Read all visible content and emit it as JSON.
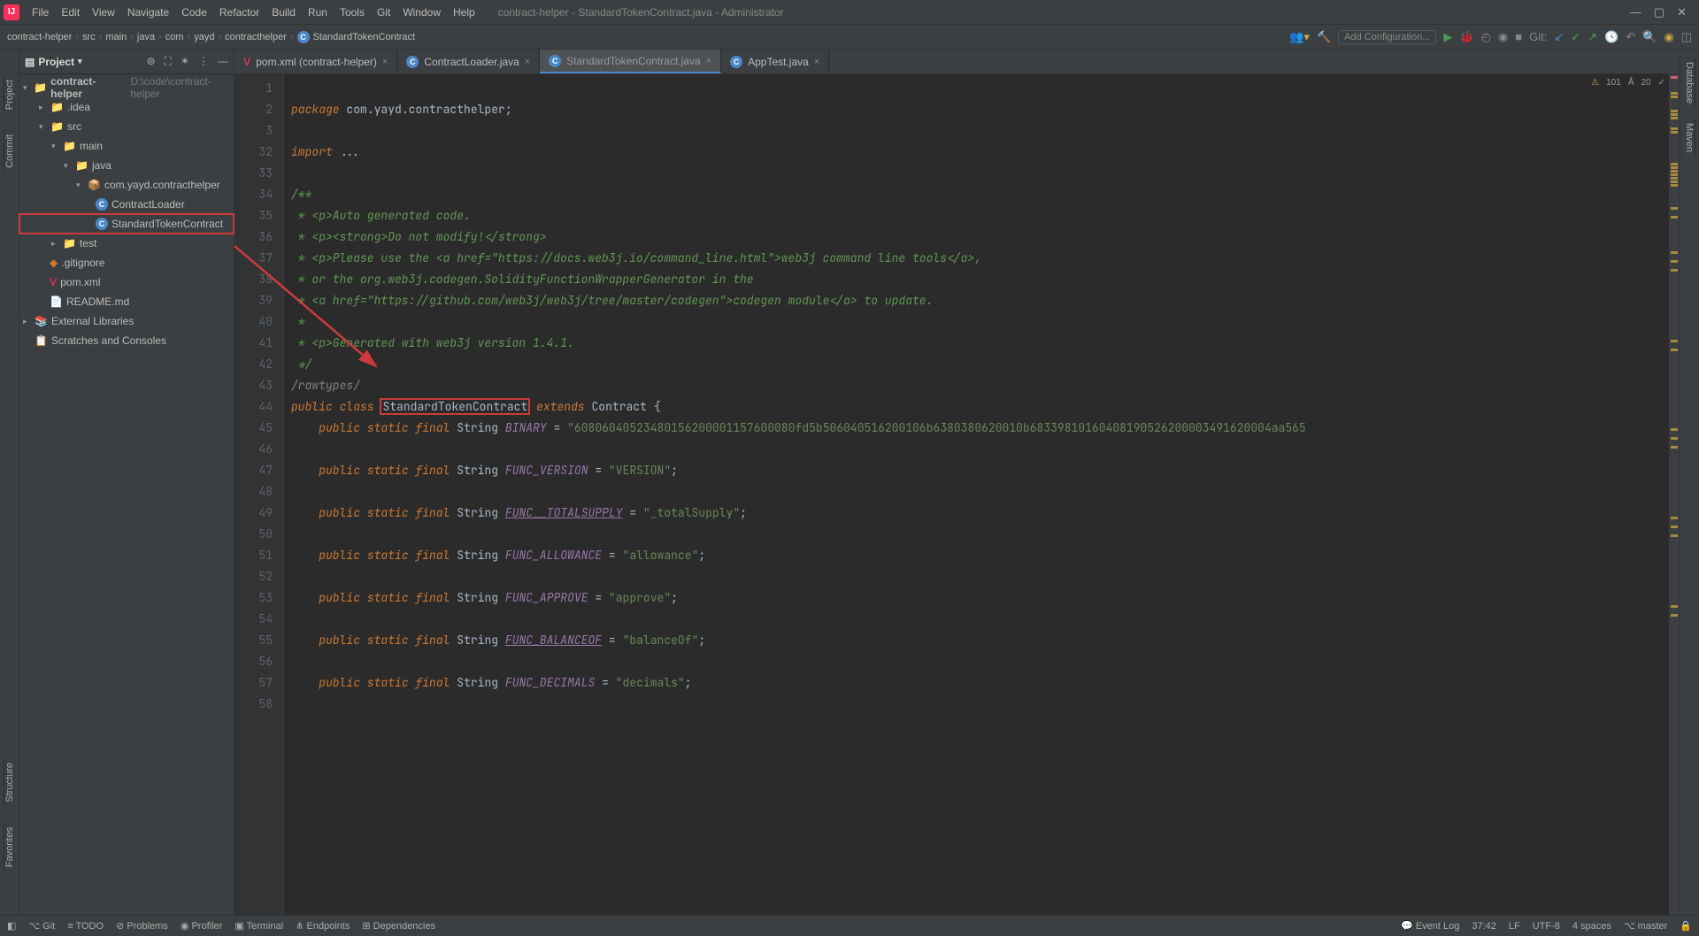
{
  "title": "contract-helper - StandardTokenContract.java - Administrator",
  "menus": [
    "File",
    "Edit",
    "View",
    "Navigate",
    "Code",
    "Refactor",
    "Build",
    "Run",
    "Tools",
    "Git",
    "Window",
    "Help"
  ],
  "breadcrumbs": [
    "contract-helper",
    "src",
    "main",
    "java",
    "com",
    "yayd",
    "contracthelper",
    "StandardTokenContract"
  ],
  "add_config": "Add Configuration...",
  "git_label": "Git:",
  "left_tabs": {
    "project": "Project",
    "commit": "Commit",
    "structure": "Structure",
    "favorites": "Favorites"
  },
  "right_tabs": {
    "database": "Database",
    "maven": "Maven"
  },
  "project_panel": {
    "title": "Project",
    "root": "contract-helper",
    "root_path": "D:\\code\\contract-helper"
  },
  "tree": {
    "idea": ".idea",
    "src": "src",
    "main": "main",
    "java": "java",
    "pkg": "com.yayd.contracthelper",
    "cl": "ContractLoader",
    "stc": "StandardTokenContract",
    "test": "test",
    "gitignore": ".gitignore",
    "pom": "pom.xml",
    "readme": "README.md",
    "ext": "External Libraries",
    "scratches": "Scratches and Consoles"
  },
  "tabs": [
    {
      "label": "pom.xml (contract-helper)"
    },
    {
      "label": "ContractLoader.java"
    },
    {
      "label": "StandardTokenContract.java",
      "active": true
    },
    {
      "label": "AppTest.java"
    }
  ],
  "gutter_lines": [
    "1",
    "2",
    "3",
    "32",
    "33",
    "34",
    "35",
    "36",
    "37",
    "38",
    "39",
    "40",
    "41",
    "42",
    "43",
    "44",
    "45",
    "46",
    "47",
    "48",
    "49",
    "50",
    "51",
    "52",
    "53",
    "54",
    "55",
    "56",
    "57",
    "58"
  ],
  "code": {
    "pkg": "package",
    "pkg_name": "com.yayd.contracthelper",
    "imp": "import",
    "imp_rest": "...",
    "c1": "/**",
    "c2": " * <p>Auto generated code.",
    "c3": " * <p><strong>Do not modify!</strong>",
    "c4": " * <p>Please use the <a href=\"https://docs.web3j.io/command_line.html\">web3j command line tools</a>,",
    "c5": " * or the org.web3j.codegen.SolidityFunctionWrapperGenerator in the",
    "c6": " * <a href=\"https://github.com/web3j/web3j/tree/master/codegen\">codegen module</a> to update.",
    "c7": " *",
    "c8": " * <p>Generated with web3j version 1.4.1.",
    "c9": " */",
    "raw": "/rawtypes/",
    "pub": "public",
    "cls": "class",
    "clsname": "StandardTokenContract",
    "ext": "extends",
    "sup": "Contract",
    "stat": "static",
    "fin": "final",
    "str": "String",
    "f_bin": "BINARY",
    "v_bin": "\"60806040523480156200001157600080fd5b506040516200106b6380380620010b68339810160408190526200003491620004aa565",
    "f_ver": "FUNC_VERSION",
    "v_ver": "\"VERSION\"",
    "f_ts": "FUNC__TOTALSUPPLY",
    "v_ts": "\"_totalSupply\"",
    "f_al": "FUNC_ALLOWANCE",
    "v_al": "\"allowance\"",
    "f_ap": "FUNC_APPROVE",
    "v_ap": "\"approve\"",
    "f_bo": "FUNC_BALANCEOF",
    "v_bo": "\"balanceOf\"",
    "f_dc": "FUNC_DECIMALS",
    "v_dc": "\"decimals\""
  },
  "editor_status": {
    "warn": "101",
    "up": "20",
    "check": "✓"
  },
  "bottom": {
    "git": "Git",
    "todo": "TODO",
    "problems": "Problems",
    "profiler": "Profiler",
    "terminal": "Terminal",
    "endpoints": "Endpoints",
    "deps": "Dependencies",
    "event_log": "Event Log"
  },
  "status": {
    "pos": "37:42",
    "lf": "LF",
    "enc": "UTF-8",
    "indent": "4 spaces",
    "branch": "master"
  }
}
